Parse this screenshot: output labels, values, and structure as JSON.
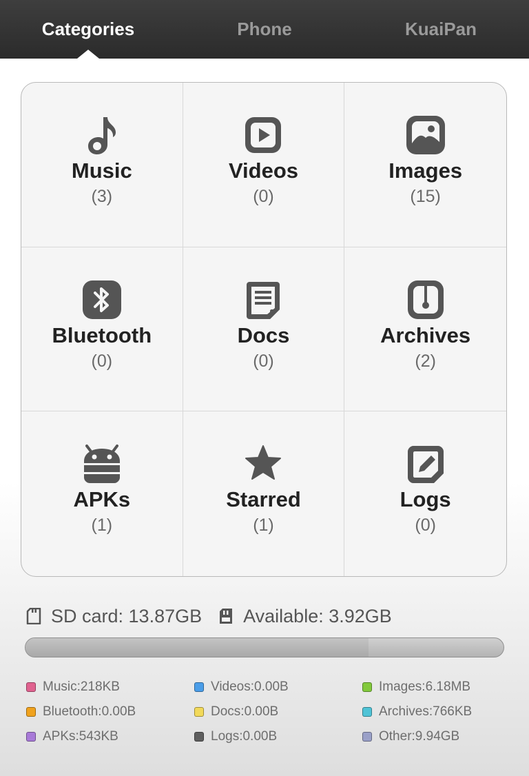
{
  "tabs": [
    {
      "label": "Categories",
      "active": true
    },
    {
      "label": "Phone",
      "active": false
    },
    {
      "label": "KuaiPan",
      "active": false
    }
  ],
  "categories": [
    {
      "name": "Music",
      "count": "(3)",
      "icon": "music-note-icon"
    },
    {
      "name": "Videos",
      "count": "(0)",
      "icon": "play-icon"
    },
    {
      "name": "Images",
      "count": "(15)",
      "icon": "image-icon"
    },
    {
      "name": "Bluetooth",
      "count": "(0)",
      "icon": "bluetooth-icon"
    },
    {
      "name": "Docs",
      "count": "(0)",
      "icon": "document-icon"
    },
    {
      "name": "Archives",
      "count": "(2)",
      "icon": "archive-icon"
    },
    {
      "name": "APKs",
      "count": "(1)",
      "icon": "android-icon"
    },
    {
      "name": "Starred",
      "count": "(1)",
      "icon": "star-icon"
    },
    {
      "name": "Logs",
      "count": "(0)",
      "icon": "log-edit-icon"
    }
  ],
  "storage": {
    "sd_card": "SD card: 13.87GB",
    "available": "Available: 3.92GB",
    "used_fraction": 0.717
  },
  "legend": [
    {
      "label": "Music:218KB",
      "color": "#e0628f"
    },
    {
      "label": "Videos:0.00B",
      "color": "#4a9de8"
    },
    {
      "label": "Images:6.18MB",
      "color": "#82c93c"
    },
    {
      "label": "Bluetooth:0.00B",
      "color": "#f0a21e"
    },
    {
      "label": "Docs:0.00B",
      "color": "#f2d95a"
    },
    {
      "label": "Archives:766KB",
      "color": "#4fc3d6"
    },
    {
      "label": "APKs:543KB",
      "color": "#a87ad8"
    },
    {
      "label": "Logs:0.00B",
      "color": "#5e5e5e"
    },
    {
      "label": "Other:9.94GB",
      "color": "#9aa0c8"
    }
  ]
}
